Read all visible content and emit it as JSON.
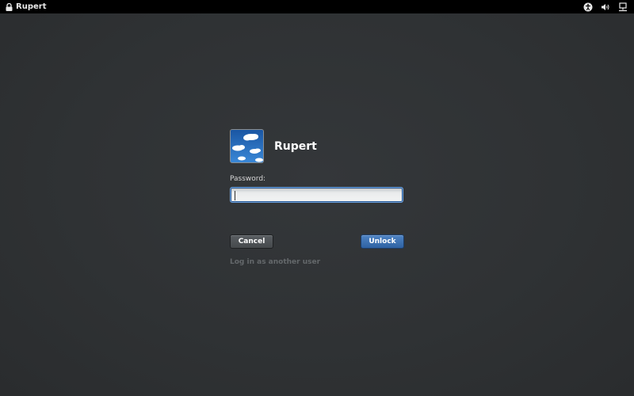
{
  "topbar": {
    "lock_icon": "lock-icon",
    "user_name": "Rupert",
    "accessibility_icon": "accessibility-icon",
    "volume_icon": "volume-icon",
    "network_icon": "network-wired-icon"
  },
  "login": {
    "avatar_icon": "user-avatar-clouds",
    "username": "Rupert",
    "password_label": "Password:",
    "password_value": "",
    "cancel_label": "Cancel",
    "unlock_label": "Unlock",
    "other_user_link": "Log in as another user"
  },
  "colors": {
    "background": "#2e3133",
    "topbar": "#000000",
    "accent_blue": "#3f74b7",
    "muted_link": "#64686b"
  }
}
